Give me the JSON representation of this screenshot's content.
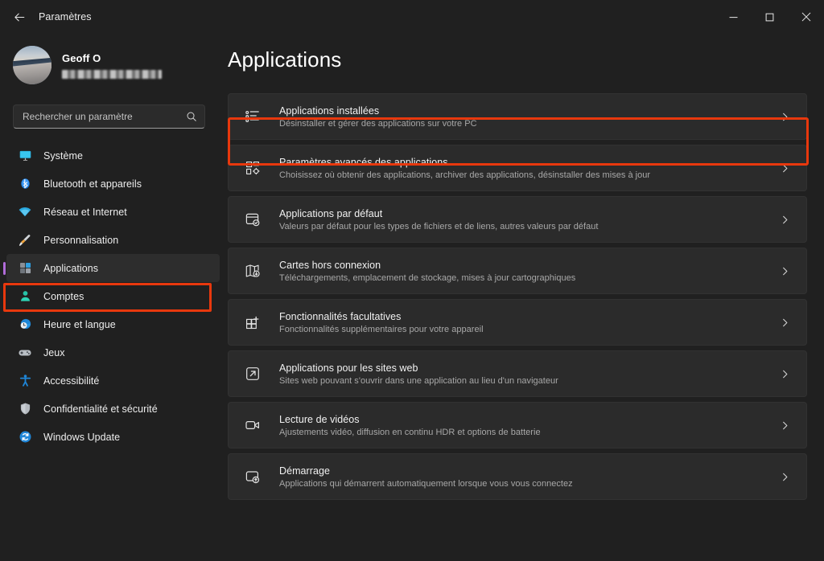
{
  "window": {
    "title": "Paramètres",
    "back_icon": "back-arrow-icon",
    "minimize_label": "—",
    "maximize_label": "□",
    "close_label": "✕"
  },
  "account": {
    "name": "Geoff O",
    "email_redacted": "",
    "avatar_icon": "user-avatar-photo"
  },
  "search": {
    "placeholder": "Rechercher un paramètre",
    "value": "",
    "icon": "search-icon"
  },
  "sidebar": {
    "items": [
      {
        "label": "Système",
        "icon": "monitor-icon",
        "selected": false
      },
      {
        "label": "Bluetooth et appareils",
        "icon": "bluetooth-icon",
        "selected": false
      },
      {
        "label": "Réseau et Internet",
        "icon": "wifi-icon",
        "selected": false
      },
      {
        "label": "Personnalisation",
        "icon": "paintbrush-icon",
        "selected": false
      },
      {
        "label": "Applications",
        "icon": "apps-icon",
        "selected": true
      },
      {
        "label": "Comptes",
        "icon": "person-icon",
        "selected": false
      },
      {
        "label": "Heure et langue",
        "icon": "clock-globe-icon",
        "selected": false
      },
      {
        "label": "Jeux",
        "icon": "gamepad-icon",
        "selected": false
      },
      {
        "label": "Accessibilité",
        "icon": "accessibility-icon",
        "selected": false
      },
      {
        "label": "Confidentialité et sécurité",
        "icon": "shield-icon",
        "selected": false
      },
      {
        "label": "Windows Update",
        "icon": "update-refresh-icon",
        "selected": false
      }
    ]
  },
  "main": {
    "page_title": "Applications",
    "cards": [
      {
        "title": "Applications installées",
        "subtitle": "Désinstaller et gérer des applications sur votre PC",
        "icon": "installed-apps-list-icon",
        "highlighted": true
      },
      {
        "title": "Paramètres avancés des applications",
        "subtitle": "Choisissez où obtenir des applications, archiver des applications, désinstaller des mises à jour",
        "icon": "app-settings-gear-icon",
        "highlighted": false
      },
      {
        "title": "Applications par défaut",
        "subtitle": "Valeurs par défaut pour les types de fichiers et de liens, autres valeurs par défaut",
        "icon": "default-apps-check-icon",
        "highlighted": false
      },
      {
        "title": "Cartes hors connexion",
        "subtitle": "Téléchargements, emplacement de stockage, mises à jour cartographiques",
        "icon": "offline-maps-icon",
        "highlighted": false
      },
      {
        "title": "Fonctionnalités facultatives",
        "subtitle": "Fonctionnalités supplémentaires pour votre appareil",
        "icon": "optional-features-plus-icon",
        "highlighted": false
      },
      {
        "title": "Applications pour les sites web",
        "subtitle": "Sites web pouvant s'ouvrir dans une application au lieu d'un navigateur",
        "icon": "web-apps-external-link-icon",
        "highlighted": false
      },
      {
        "title": "Lecture de vidéos",
        "subtitle": "Ajustements vidéo, diffusion en continu HDR et options de batterie",
        "icon": "video-playback-camera-icon",
        "highlighted": false
      },
      {
        "title": "Démarrage",
        "subtitle": "Applications qui démarrent automatiquement lorsque vous vous connectez",
        "icon": "startup-apps-icon",
        "highlighted": false
      }
    ],
    "chevron_icon": "chevron-right-icon"
  },
  "colors": {
    "background": "#202020",
    "card": "#2b2b2b",
    "accent_selected": "#b16cd9",
    "highlight_box": "#e8380d",
    "text_primary": "#f2f2f2",
    "text_secondary": "#a8a8a8"
  }
}
